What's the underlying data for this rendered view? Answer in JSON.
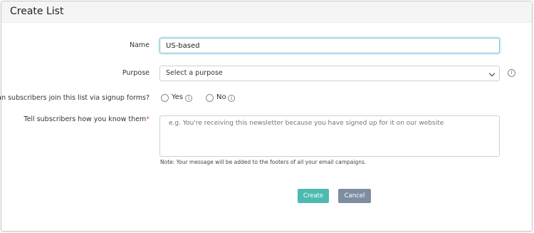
{
  "dialog": {
    "title": "Create List"
  },
  "form": {
    "name": {
      "label": "Name",
      "value": "US-based"
    },
    "purpose": {
      "label": "Purpose",
      "selected": "Select a purpose",
      "icon": "info-icon"
    },
    "signup": {
      "label": "Can subscribers join this list via signup forms?",
      "options": [
        {
          "label": "Yes",
          "selected": false
        },
        {
          "label": "No",
          "selected": false
        }
      ]
    },
    "reminder": {
      "label": "Tell subscribers how you know them",
      "required_mark": "*",
      "placeholder": "e.g. You're receiving this newsletter because you have signed up for it on our website",
      "note": "Note: Your message will be added to the footers of all your email campaigns."
    }
  },
  "actions": {
    "create_label": "Create",
    "cancel_label": "Cancel"
  },
  "colors": {
    "accent": "#4dbab0",
    "secondary": "#7f8da3",
    "focus": "#78c4d6",
    "required": "#d9534f"
  }
}
